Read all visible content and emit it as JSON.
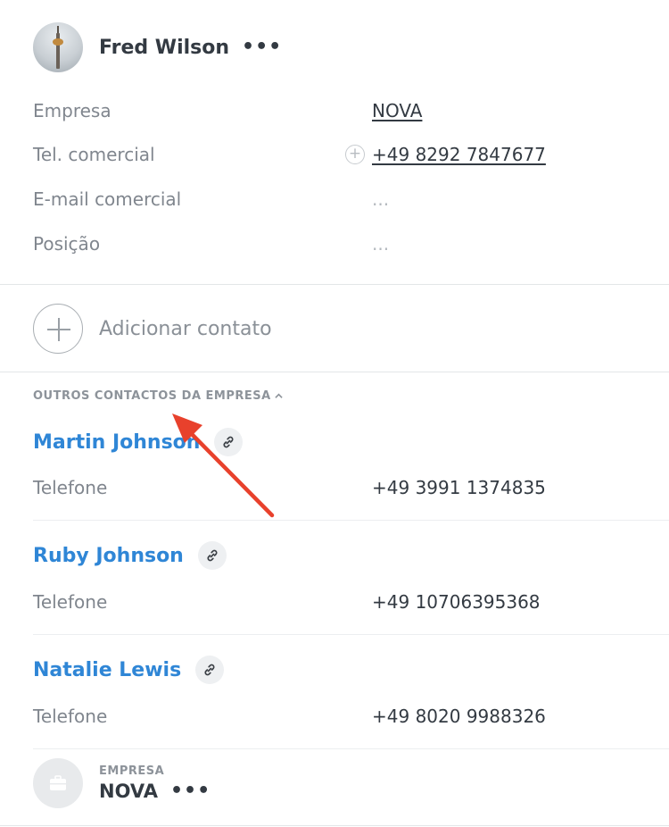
{
  "contact": {
    "name": "Fred Wilson",
    "more": "•••",
    "fields": [
      {
        "label": "Empresa",
        "value": "NOVA"
      },
      {
        "label": "Tel. comercial",
        "value": "+49 8292 7847677"
      },
      {
        "label": "E-mail comercial",
        "value": "..."
      },
      {
        "label": "Posição",
        "value": "..."
      }
    ]
  },
  "add_contact": {
    "label": "Adicionar contato"
  },
  "other_contacts": {
    "title": "OUTROS CONTACTOS DA EMPRESA",
    "items": [
      {
        "name": "Martin Johnson",
        "phone_label": "Telefone",
        "phone": "+49 3991 1374835"
      },
      {
        "name": "Ruby Johnson",
        "phone_label": "Telefone",
        "phone": "+49 10706395368"
      },
      {
        "name": "Natalie Lewis",
        "phone_label": "Telefone",
        "phone": "+49 8020 9988326"
      }
    ]
  },
  "company": {
    "label": "EMPRESA",
    "name": "NOVA",
    "more": "•••"
  },
  "colors": {
    "accent": "#2f86d6",
    "annotation": "#e8412c"
  }
}
